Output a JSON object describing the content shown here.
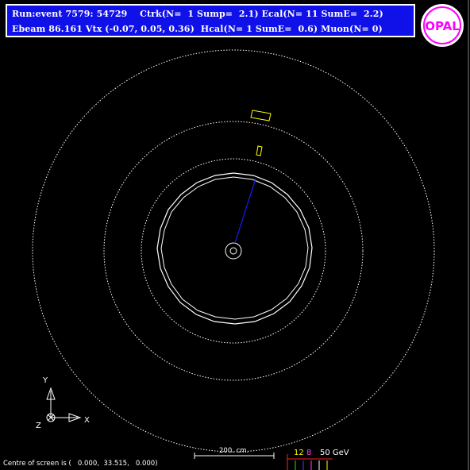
{
  "header": {
    "line1": "Run:event 7579: 54729    Ctrk(N=  1 Sump=  2.1) Ecal(N= 11 SumE=  2.2)",
    "line2": "Ebeam 86.161 Vtx (-0.07, 0.05, 0.36)  Hcal(N= 1 SumE=  0.6) Muon(N= 0)"
  },
  "logo": {
    "text": "OPAL",
    "ring_color": "#ff00ff",
    "letter_color": "#ff00ff"
  },
  "axes": {
    "x_label": "X",
    "y_label": "Y",
    "z_label": "Z"
  },
  "scale": {
    "label": "200. cm."
  },
  "histogram": {
    "label_12": "12",
    "label_8": "8",
    "label_50": "50 GeV"
  },
  "footer": {
    "centre_text": "Centre of screen is (   0.000,  33.515,   0.000)"
  },
  "colors": {
    "background": "#000000",
    "panel": "#1010e8",
    "detector_lines": "#ffffff",
    "track": "#1a1aff",
    "calorimeter_hits": "#ffff00",
    "hist_red": "#ff2020",
    "hist_green": "#20e020",
    "hist_blue": "#4040ff",
    "hist_magenta": "#ff40ff"
  }
}
